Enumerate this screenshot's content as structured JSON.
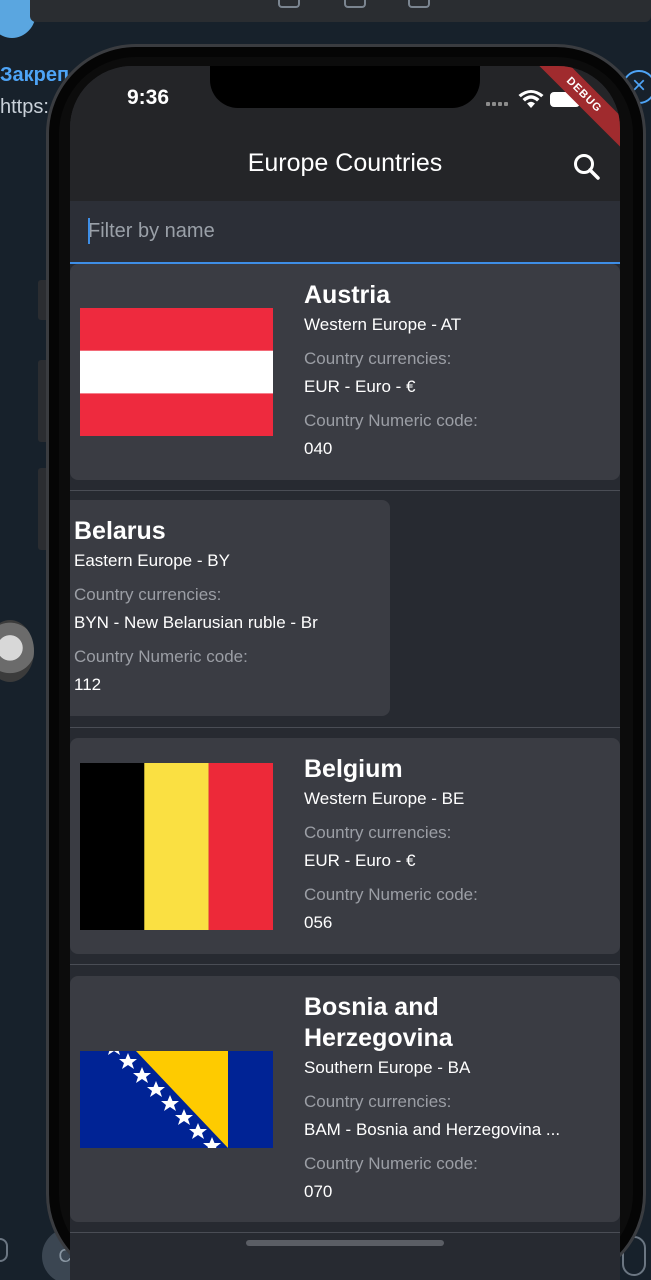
{
  "background": {
    "pinned_title": "Закреп",
    "pinned_link": "https:",
    "input_hint": "Co"
  },
  "status": {
    "time": "9:36",
    "debug_banner": "DEBUG"
  },
  "appbar": {
    "title": "Europe Countries"
  },
  "filter": {
    "placeholder": "Filter by name"
  },
  "labels": {
    "currencies": "Country currencies:",
    "numeric_code": "Country Numeric code:"
  },
  "countries": [
    {
      "name": "Austria",
      "region": "Western Europe - AT",
      "currency": "EUR - Euro - €",
      "numeric_code": "040"
    },
    {
      "name": "Belarus",
      "region": "Eastern Europe - BY",
      "currency": "BYN - New Belarusian ruble - Br",
      "numeric_code": "112"
    },
    {
      "name": "Belgium",
      "region": "Western Europe - BE",
      "currency": "EUR - Euro - €",
      "numeric_code": "056"
    },
    {
      "name": "Bosnia and Herzegovina",
      "region": "Southern Europe - BA",
      "currency": "BAM - Bosnia and Herzegovina ...",
      "numeric_code": "070"
    }
  ],
  "colors": {
    "accent": "#3e8ee6",
    "card": "#3a3c43",
    "screen_bg": "#272a31"
  }
}
